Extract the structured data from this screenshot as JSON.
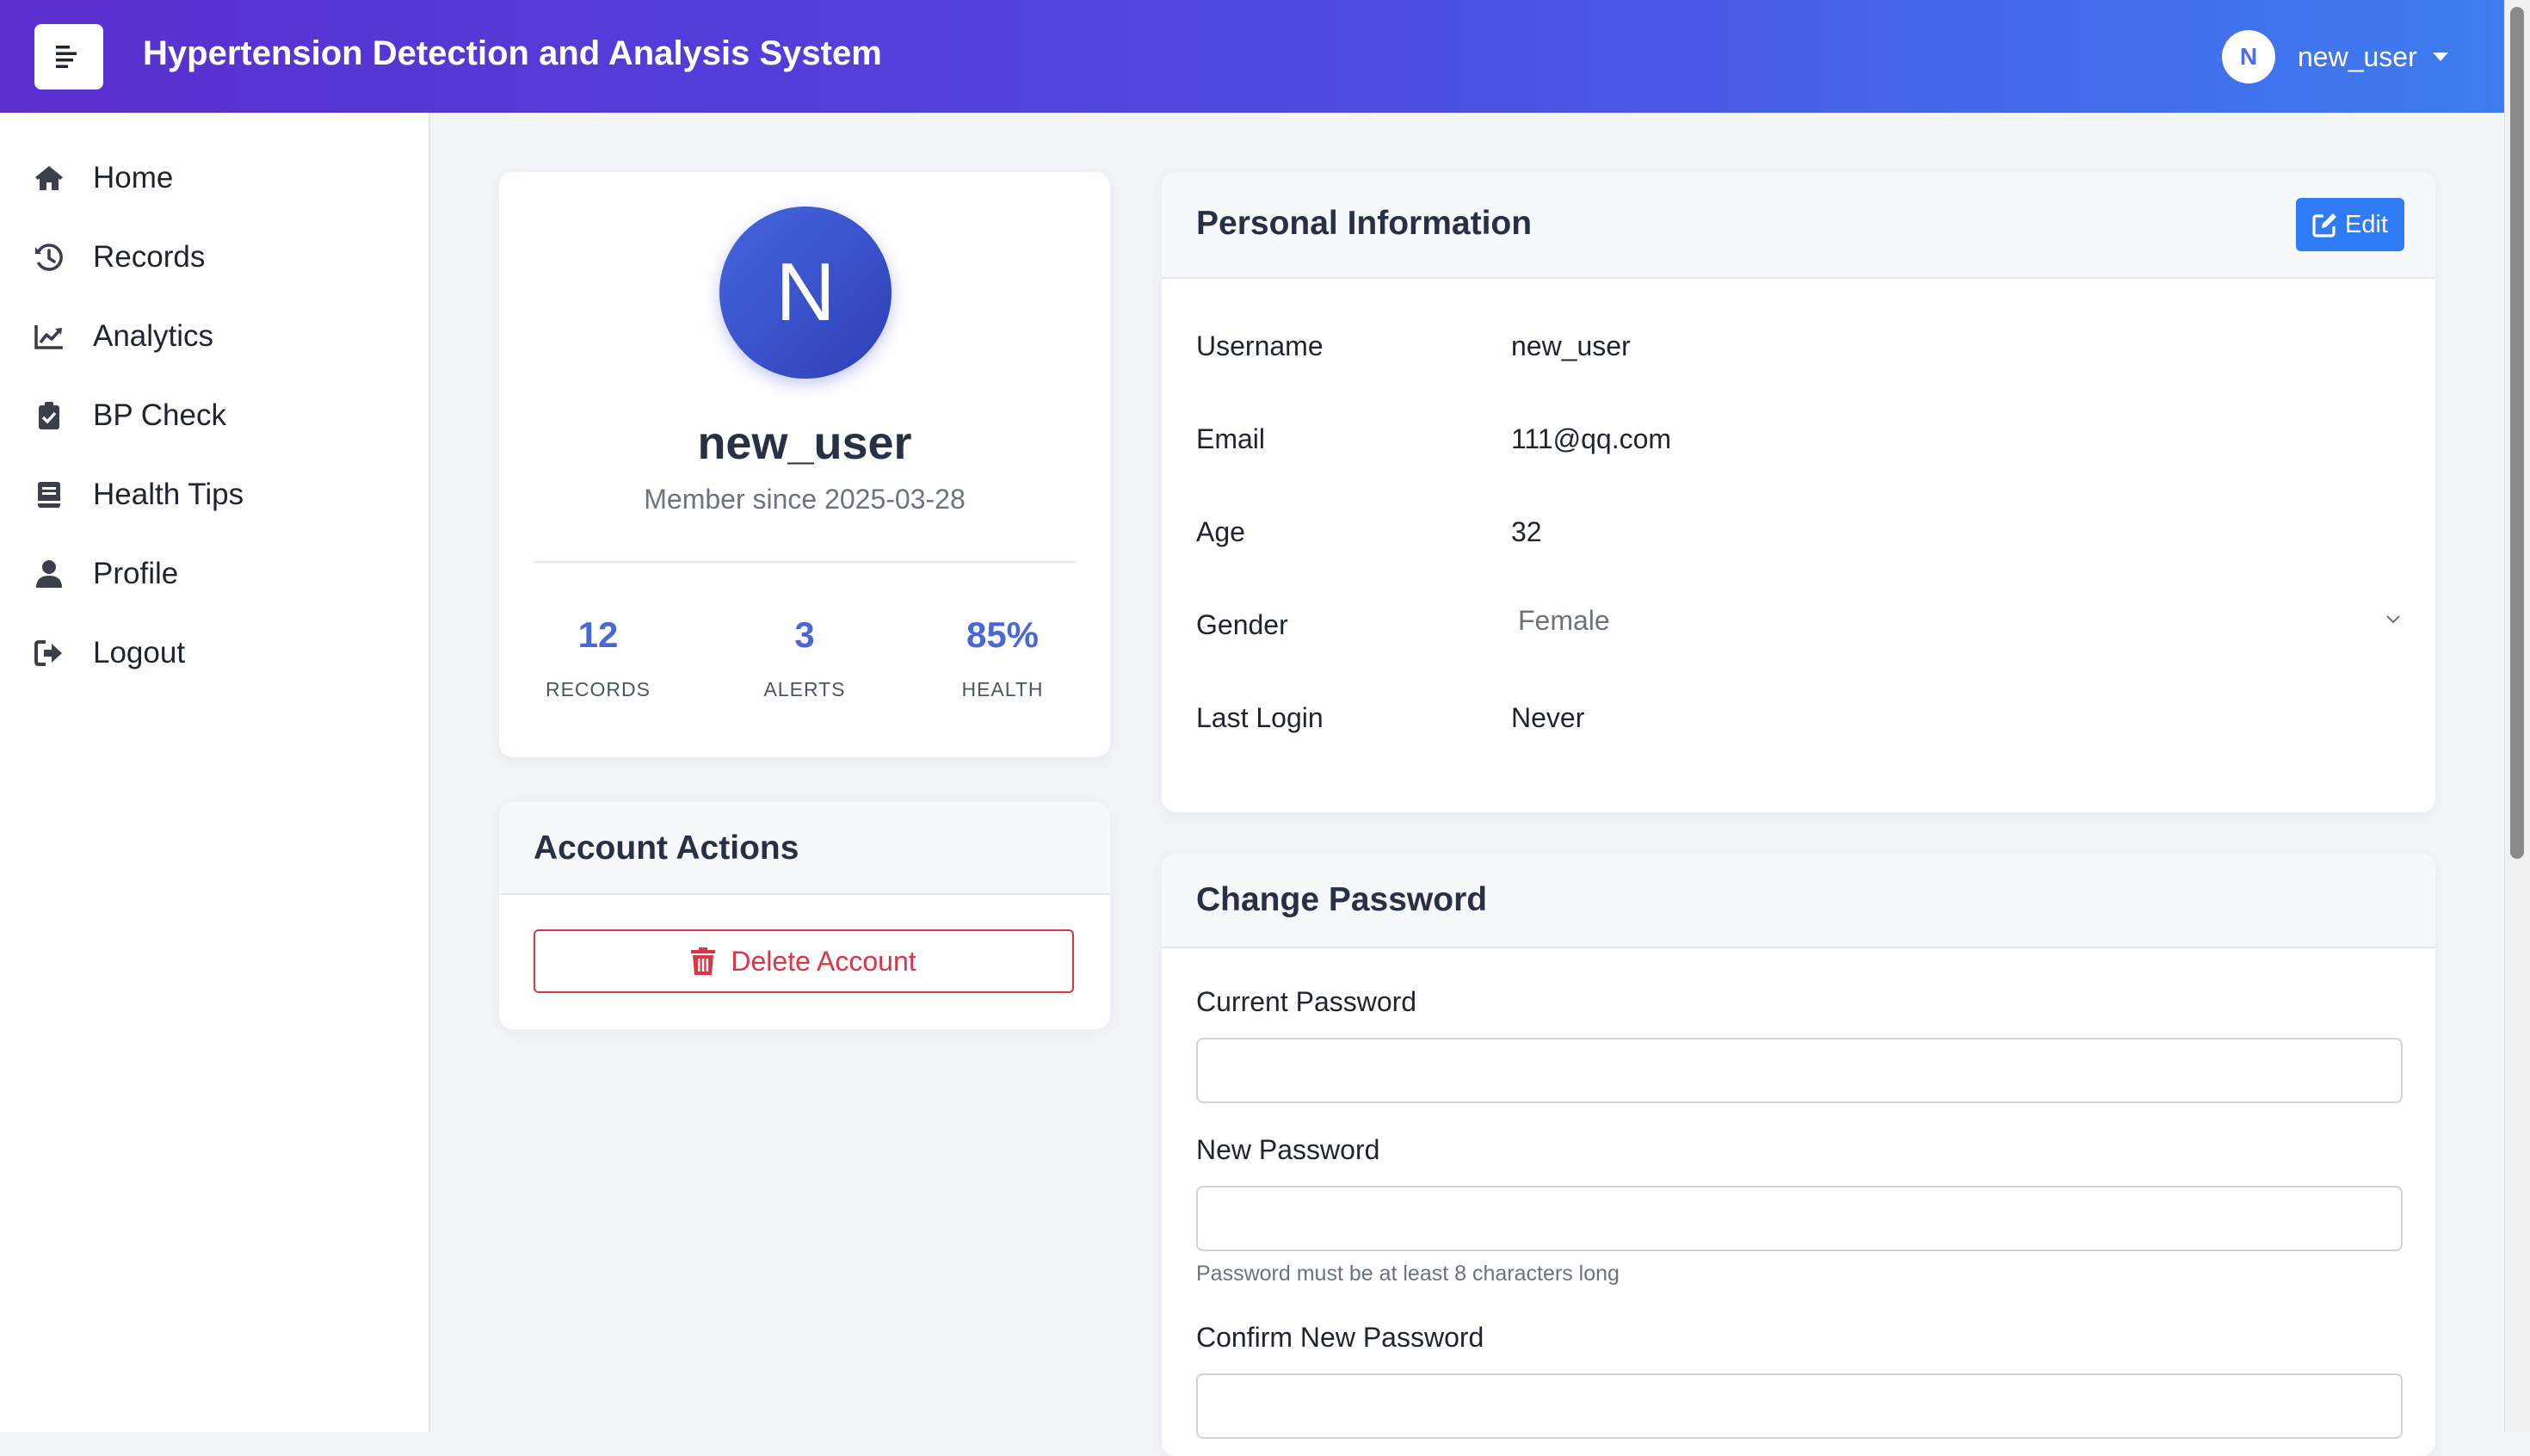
{
  "header": {
    "app_title": "Hypertension Detection and Analysis System",
    "user_initial": "N",
    "username": "new_user"
  },
  "sidebar": {
    "items": [
      {
        "label": "Home",
        "icon": "home-icon"
      },
      {
        "label": "Records",
        "icon": "history-icon"
      },
      {
        "label": "Analytics",
        "icon": "chart-line-icon"
      },
      {
        "label": "BP Check",
        "icon": "clipboard-check-icon"
      },
      {
        "label": "Health Tips",
        "icon": "book-icon"
      },
      {
        "label": "Profile",
        "icon": "user-icon"
      },
      {
        "label": "Logout",
        "icon": "sign-out-icon"
      }
    ]
  },
  "profile_card": {
    "avatar_initial": "N",
    "name": "new_user",
    "member_since": "Member since 2025-03-28",
    "stats": [
      {
        "value": "12",
        "label": "RECORDS"
      },
      {
        "value": "3",
        "label": "ALERTS"
      },
      {
        "value": "85%",
        "label": "HEALTH"
      }
    ]
  },
  "account_actions": {
    "title": "Account Actions",
    "delete_label": "Delete Account"
  },
  "personal_info": {
    "title": "Personal Information",
    "edit_label": "Edit",
    "username_label": "Username",
    "username_value": "new_user",
    "email_label": "Email",
    "email_value": "111@qq.com",
    "age_label": "Age",
    "age_value": "32",
    "gender_label": "Gender",
    "gender_value": "Female",
    "last_login_label": "Last Login",
    "last_login_value": "Never"
  },
  "change_password": {
    "title": "Change Password",
    "current_label": "Current Password",
    "current_value": "",
    "new_label": "New Password",
    "new_value": "",
    "new_help": "Password must be at least 8 characters long",
    "confirm_label": "Confirm New Password",
    "confirm_value": ""
  },
  "colors": {
    "header_gradient_start": "#5b2fce",
    "header_gradient_end": "#3d7df0",
    "accent_blue": "#4668d8",
    "edit_button": "#2f7cf6",
    "danger": "#dc3545"
  }
}
